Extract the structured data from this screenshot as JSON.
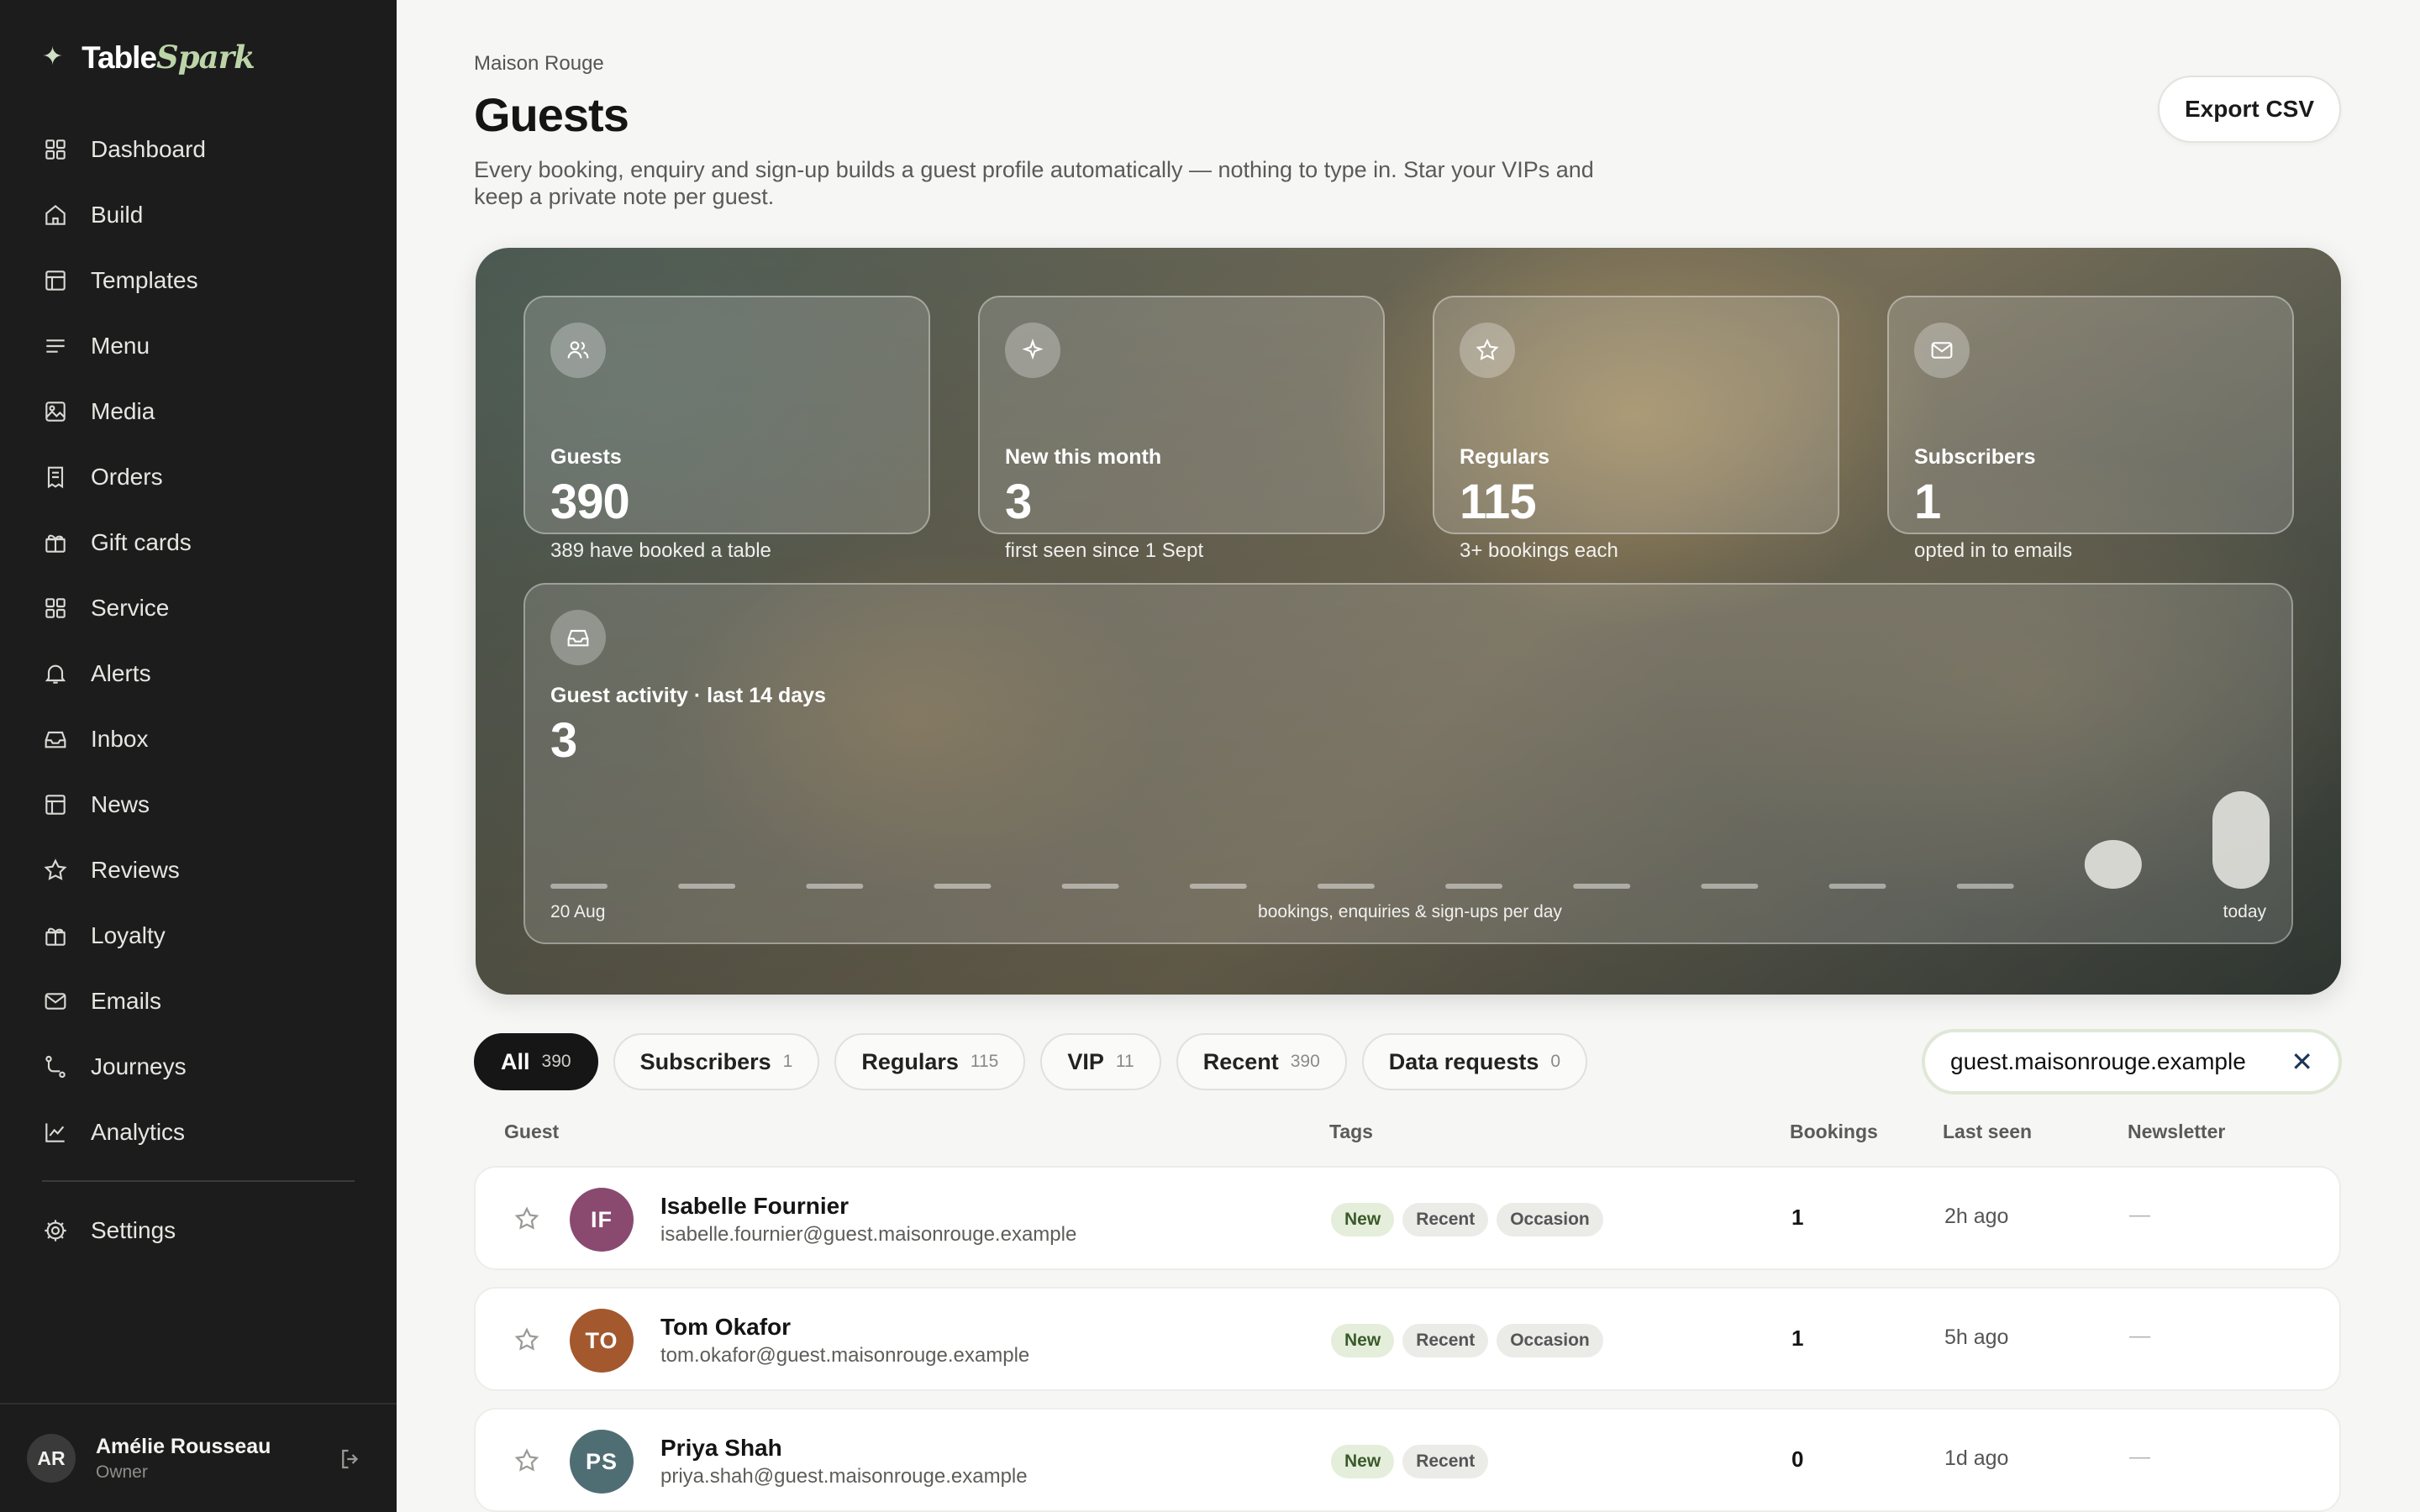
{
  "brand": {
    "prefix": "Table",
    "accent": "Spark"
  },
  "nav": [
    {
      "label": "Dashboard",
      "icon": "grid-icon"
    },
    {
      "label": "Build",
      "icon": "home-icon"
    },
    {
      "label": "Templates",
      "icon": "layout-icon"
    },
    {
      "label": "Menu",
      "icon": "lines-icon"
    },
    {
      "label": "Media",
      "icon": "image-icon"
    },
    {
      "label": "Orders",
      "icon": "receipt-icon"
    },
    {
      "label": "Gift cards",
      "icon": "gift-icon"
    },
    {
      "label": "Service",
      "icon": "grid-icon"
    },
    {
      "label": "Alerts",
      "icon": "bell-icon"
    },
    {
      "label": "Inbox",
      "icon": "inbox-icon"
    },
    {
      "label": "News",
      "icon": "layout-icon"
    },
    {
      "label": "Reviews",
      "icon": "star-icon"
    },
    {
      "label": "Loyalty",
      "icon": "gift-icon"
    },
    {
      "label": "Emails",
      "icon": "mail-icon"
    },
    {
      "label": "Journeys",
      "icon": "route-icon"
    },
    {
      "label": "Analytics",
      "icon": "chart-icon"
    }
  ],
  "settings_label": "Settings",
  "user": {
    "initials": "AR",
    "name": "Amélie Rousseau",
    "role": "Owner"
  },
  "header": {
    "crumb": "Maison Rouge",
    "title": "Guests",
    "description": "Every booking, enquiry and sign-up builds a guest profile automatically — nothing to type in. Star your VIPs and keep a private note per guest.",
    "export_label": "Export CSV"
  },
  "stats": [
    {
      "label": "Guests",
      "value": "390",
      "sub": "389 have booked a table",
      "icon": "users-icon"
    },
    {
      "label": "New this month",
      "value": "3",
      "sub": "first seen since 1 Sept",
      "icon": "sparkle-icon"
    },
    {
      "label": "Regulars",
      "value": "115",
      "sub": "3+ bookings each",
      "icon": "star-icon"
    },
    {
      "label": "Subscribers",
      "value": "1",
      "sub": "opted in to emails",
      "icon": "mail-icon"
    }
  ],
  "activity": {
    "label": "Guest activity · last 14 days",
    "value": "3",
    "start_label": "20 Aug",
    "mid_label": "bookings, enquiries & sign-ups per day",
    "end_label": "today"
  },
  "chart_data": {
    "type": "bar",
    "title": "Guest activity · last 14 days",
    "values": [
      0,
      0,
      0,
      0,
      0,
      0,
      0,
      0,
      0,
      0,
      0,
      0,
      1,
      2
    ]
  },
  "filters": [
    {
      "label": "All",
      "count": "390",
      "active": true
    },
    {
      "label": "Subscribers",
      "count": "1"
    },
    {
      "label": "Regulars",
      "count": "115"
    },
    {
      "label": "VIP",
      "count": "11"
    },
    {
      "label": "Recent",
      "count": "390"
    },
    {
      "label": "Data requests",
      "count": "0"
    }
  ],
  "search": {
    "value": "guest.maisonrouge.example",
    "clear": "✕"
  },
  "columns": {
    "guest": "Guest",
    "tags": "Tags",
    "bookings": "Bookings",
    "last_seen": "Last seen",
    "newsletter": "Newsletter"
  },
  "guests": [
    {
      "initials": "IF",
      "name": "Isabelle Fournier",
      "email": "isabelle.fournier@guest.maisonrouge.example",
      "tags": [
        "New",
        "Recent",
        "Occasion"
      ],
      "bookings": "1",
      "last_seen": "2h ago",
      "newsletter": "—",
      "color": "#8a4a6f"
    },
    {
      "initials": "TO",
      "name": "Tom Okafor",
      "email": "tom.okafor@guest.maisonrouge.example",
      "tags": [
        "New",
        "Recent",
        "Occasion"
      ],
      "bookings": "1",
      "last_seen": "5h ago",
      "newsletter": "—",
      "color": "#a4582e"
    },
    {
      "initials": "PS",
      "name": "Priya Shah",
      "email": "priya.shah@guest.maisonrouge.example",
      "tags": [
        "New",
        "Recent"
      ],
      "bookings": "0",
      "last_seen": "1d ago",
      "newsletter": "—",
      "color": "#4f6e74"
    }
  ]
}
